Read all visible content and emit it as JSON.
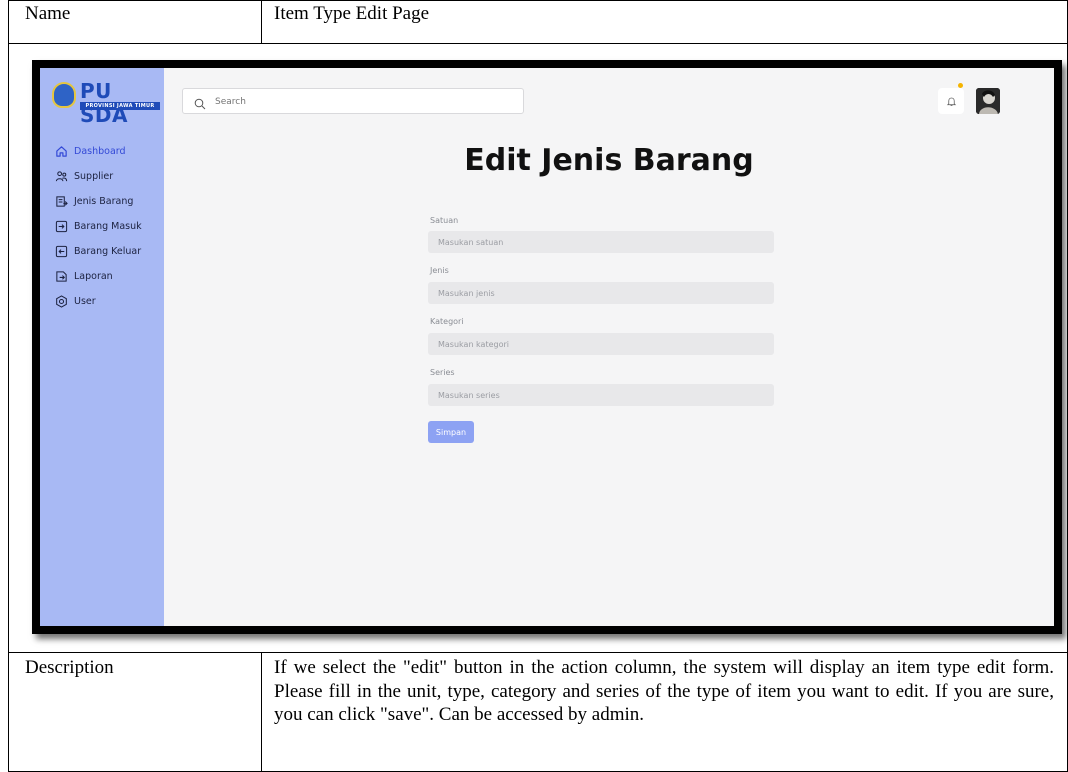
{
  "table": {
    "name_label": "Name",
    "name_value": "Item Type Edit Page",
    "description_label": "Description",
    "description_value": "If we select the \"edit\" button in the action column, the system will display an item type edit form. Please fill in the unit, type, category and series of the type of item you want to edit. If you are sure, you can click \"save\". Can be accessed by admin."
  },
  "app": {
    "logo": {
      "title": "PU SDA",
      "subtitle": "PROVINSI JAWA TIMUR"
    },
    "search": {
      "placeholder": "Search"
    },
    "sidebar": {
      "items": [
        {
          "label": "Dashboard",
          "icon": "home-icon",
          "active": true
        },
        {
          "label": "Supplier",
          "icon": "supplier-icon",
          "active": false
        },
        {
          "label": "Jenis Barang",
          "icon": "item-type-icon",
          "active": false
        },
        {
          "label": "Barang Masuk",
          "icon": "incoming-icon",
          "active": false
        },
        {
          "label": "Barang Keluar",
          "icon": "outgoing-icon",
          "active": false
        },
        {
          "label": "Laporan",
          "icon": "report-icon",
          "active": false
        },
        {
          "label": "User",
          "icon": "user-gear-icon",
          "active": false
        }
      ]
    },
    "page_title": "Edit Jenis Barang",
    "form": {
      "fields": [
        {
          "label": "Satuan",
          "placeholder": "Masukan satuan"
        },
        {
          "label": "Jenis",
          "placeholder": "Masukan jenis"
        },
        {
          "label": "Kategori",
          "placeholder": "Masukan kategori"
        },
        {
          "label": "Series",
          "placeholder": "Masukan series"
        }
      ],
      "submit_label": "Simpan"
    },
    "colors": {
      "sidebar": "#a8b9f4",
      "accent": "#3349d6",
      "button": "#8da2f3",
      "notification_dot": "#f5b400"
    }
  }
}
